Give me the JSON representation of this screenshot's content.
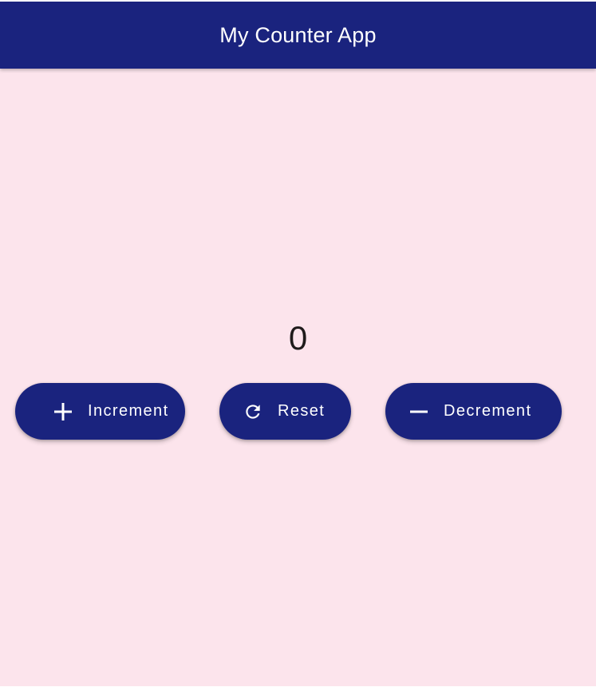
{
  "app_bar": {
    "title": "My Counter App"
  },
  "counter": {
    "value": "0"
  },
  "buttons": {
    "increment": {
      "label": "Increment",
      "icon": "plus-icon"
    },
    "reset": {
      "label": "Reset",
      "icon": "refresh-icon"
    },
    "decrement": {
      "label": "Decrement",
      "icon": "minus-icon"
    }
  },
  "colors": {
    "primary": "#1a237e",
    "background": "#fce4ec",
    "on_primary": "#ffffff",
    "text": "#1f1b1b"
  }
}
